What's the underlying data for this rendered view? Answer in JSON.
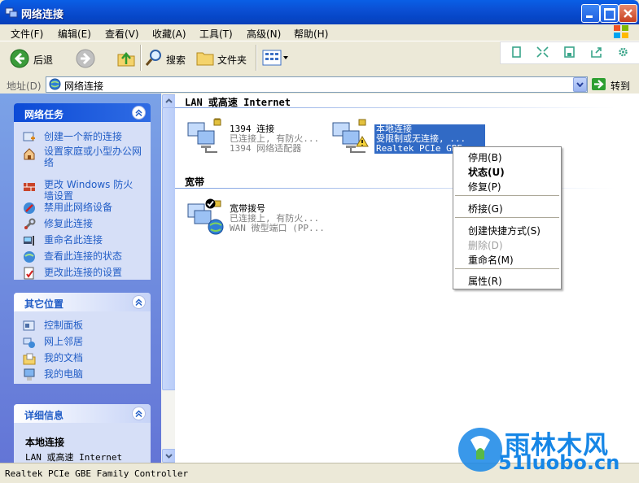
{
  "window": {
    "title": "网络连接"
  },
  "menu": [
    "文件(F)",
    "编辑(E)",
    "查看(V)",
    "收藏(A)",
    "工具(T)",
    "高级(N)",
    "帮助(H)"
  ],
  "toolbar": {
    "back_label": "后退",
    "search_label": "搜索",
    "folders_label": "文件夹"
  },
  "address": {
    "label": "地址(D)",
    "value": "网络连接",
    "go_label": "转到"
  },
  "left_panels": {
    "network_tasks": {
      "title": "网络任务",
      "items": [
        "创建一个新的连接",
        "设置家庭或小型办公网络",
        "更改 Windows 防火墙设置",
        "禁用此网络设备",
        "修复此连接",
        "重命名此连接",
        "查看此连接的状态",
        "更改此连接的设置"
      ]
    },
    "other_places": {
      "title": "其它位置",
      "items": [
        "控制面板",
        "网上邻居",
        "我的文档",
        "我的电脑"
      ]
    },
    "details": {
      "title": "详细信息",
      "name": "本地连接",
      "type": "LAN 或高速 Internet"
    }
  },
  "groups": {
    "lan": {
      "title": "LAN 或高速 Internet",
      "connections": [
        {
          "name": "1394 连接",
          "status": "已连接上, 有防火...",
          "device": "1394 网络适配器"
        },
        {
          "name": "本地连接",
          "status": "受限制或无连接, ...",
          "device": "Realtek PCIe GBE ..."
        }
      ]
    },
    "broadband": {
      "title": "宽带",
      "connections": [
        {
          "name": "宽带拨号",
          "status": "已连接上, 有防火...",
          "device": "WAN 微型端口 (PP..."
        }
      ]
    }
  },
  "context_menu": {
    "items": [
      {
        "label": "停用(B)",
        "bold": false,
        "disabled": false
      },
      {
        "label": "状态(U)",
        "bold": true,
        "disabled": false
      },
      {
        "label": "修复(P)",
        "bold": false,
        "disabled": false
      },
      {
        "label": "桥接(G)",
        "bold": false,
        "disabled": false
      },
      {
        "label": "创建快捷方式(S)",
        "bold": false,
        "disabled": false
      },
      {
        "label": "删除(D)",
        "bold": false,
        "disabled": true
      },
      {
        "label": "重命名(M)",
        "bold": false,
        "disabled": false
      },
      {
        "label": "属性(R)",
        "bold": false,
        "disabled": false
      }
    ]
  },
  "status_bar": {
    "text": "Realtek PCIe GBE Family Controller"
  },
  "watermark": {
    "brand": "雨林木风",
    "url": "51luobo.cn"
  },
  "colors": {
    "title_bar": "#0a4fd4",
    "task_link": "#215dc6",
    "selection": "#316ac5",
    "watermark": "#1686e6"
  },
  "icons": [
    "network-connections-icon",
    "back-arrow-icon",
    "forward-arrow-icon",
    "up-folder-icon",
    "search-icon",
    "folders-icon",
    "views-icon",
    "go-arrow-icon",
    "network-computer-icon",
    "warning-icon",
    "globe-icon"
  ]
}
